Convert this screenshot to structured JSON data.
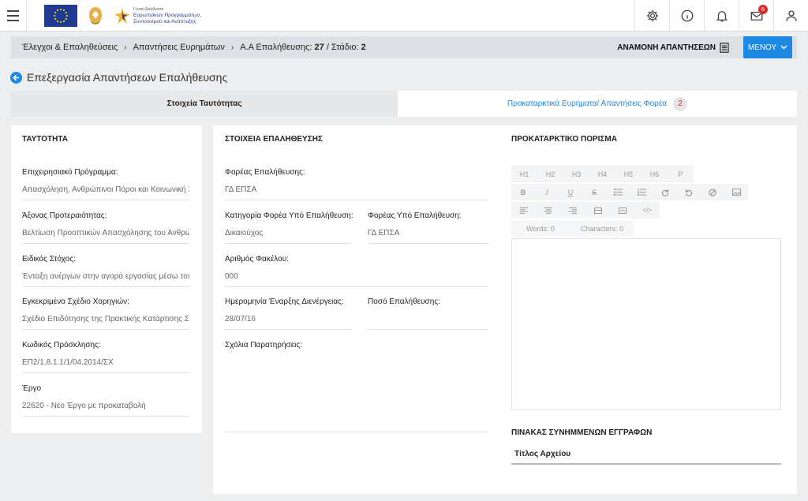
{
  "header": {
    "logo_org_line1": "Γενική Διεύθυνση",
    "logo_org_line2": "Ευρωπαϊκών Προγραμμάτων,",
    "logo_org_line3": "Συντονισμού και Ανάπτυξης",
    "notifications_badge": "6"
  },
  "breadcrumb": {
    "item1": "Έλεγχοι & Επαληθεύσεις",
    "item2": "Απαντήσεις Ευρημάτων",
    "item3_prefix": "Α.Α Επαλήθευσης:",
    "item3_number": "27",
    "item3_stage_label": "/ Στάδιο:",
    "item3_stage": "2",
    "await_label": "ΑΝΑΜΟΝΗ ΑΠΑΝΤΗΣΕΩΝ",
    "menu_label": "ΜΕΝΟΥ"
  },
  "page": {
    "title": "Επεξεργασία Απαντήσεων Επαλήθευσης"
  },
  "tabs": {
    "identity": "Στοιχεία Ταυτότητας",
    "findings": "Προκαταρκτικά Ευρήματα/ Απαντήσεις Φορέα",
    "findings_count": "2"
  },
  "identity_panel": {
    "title": "ΤΑΥΤΟΤΗΤΑ",
    "fields": [
      {
        "label": "Επιχειρησιακό Πρόγραμμα:",
        "value": "Απασχόληση, Ανθρώπινοι Πόροι και Κοινωνική Σ"
      },
      {
        "label": "Άξονας Προτεραιότητας:",
        "value": "Βελτίωση Προοπτικών Απασχόλησης του Ανθρώ"
      },
      {
        "label": "Ειδικός Στόχος:",
        "value": "Ένταξη ανέργων στην αγορά εργασίας μέσω τοπ"
      },
      {
        "label": "Εγκεκριμένο Σχέδιο Χορηγιών:",
        "value": "Σχέδιο Επιδότησης της Πρακτικής Κατάρτισης Σ"
      },
      {
        "label": "Κωδικός Πρόσκλησης:",
        "value": "ΕΠ2/1.8.1.1/1/04.2014/ΣΧ"
      },
      {
        "label": "Έργο",
        "value": "22620 - Νέο Έργο με προκαταβολή"
      }
    ]
  },
  "verification": {
    "title": "ΣΤΟΙΧΕΙΑ ΕΠΑΛΗΘΕΥΣΗΣ",
    "body_label": "Φορέας Επαλήθευσης:",
    "body_value": "ΓΔ ΕΠΣΑ",
    "category_label": "Κατηγορία Φορέα Υπό Επαλήθευση:",
    "category_value": "Δικαιούχος",
    "entity_label": "Φορέας Υπό Επαλήθευση:",
    "entity_value": "ΓΔ ΕΠΣΑ",
    "file_label": "Αριθμός Φακέλου:",
    "file_value": "000",
    "start_label": "Ημερομηνία Έναρξης Διενέργειας:",
    "start_value": "28/07/16",
    "amount_label": "Ποσό Επαλήθευσης:",
    "amount_value": "",
    "comments_label": "Σχόλια Παρατηρήσεις:"
  },
  "conclusion": {
    "title": "ΠΡΟΚΑΤΑΡΚΤΙΚΟ ΠΟΡΙΣΜΑ",
    "toolbar_row1": [
      "H1",
      "H2",
      "H3",
      "H4",
      "H5",
      "H6",
      "P"
    ],
    "words_label": "Words: 0",
    "characters_label": "Characters: 0"
  },
  "attachments": {
    "title": "ΠΙΝΑΚΑΣ ΣΥΝΗΜΜΕΝΩΝ ΕΓΓΡΑΦΩΝ",
    "col_title": "Τίτλος Αρχείου"
  },
  "colors": {
    "accent": "#1e88e5",
    "badge": "#d32f2f"
  }
}
